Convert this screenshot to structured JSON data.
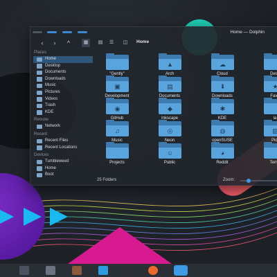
{
  "window": {
    "title": "Home — Dolphin",
    "breadcrumb": "Home"
  },
  "sidebar": {
    "sections": [
      {
        "label": "Places",
        "items": [
          {
            "label": "Home",
            "icon": "home-icon",
            "active": true
          },
          {
            "label": "Desktop",
            "icon": "desktop-icon"
          },
          {
            "label": "Documents",
            "icon": "documents-icon"
          },
          {
            "label": "Downloads",
            "icon": "downloads-icon"
          },
          {
            "label": "Music",
            "icon": "music-icon"
          },
          {
            "label": "Pictures",
            "icon": "pictures-icon"
          },
          {
            "label": "Videos",
            "icon": "videos-icon"
          },
          {
            "label": "Trash",
            "icon": "trash-icon"
          },
          {
            "label": "KDE",
            "icon": "kde-icon"
          }
        ]
      },
      {
        "label": "Remote",
        "items": [
          {
            "label": "Network",
            "icon": "network-icon"
          }
        ]
      },
      {
        "label": "Recent",
        "items": [
          {
            "label": "Recent Files",
            "icon": "recent-files-icon"
          },
          {
            "label": "Recent Locations",
            "icon": "recent-locations-icon"
          }
        ]
      },
      {
        "label": "Devices",
        "items": [
          {
            "label": "Tumbleweed",
            "icon": "drive-icon"
          },
          {
            "label": "Home",
            "icon": "drive-icon"
          },
          {
            "label": "Boot",
            "icon": "drive-icon"
          }
        ]
      }
    ]
  },
  "files": [
    {
      "label": "\"Gently\"",
      "glyph": ""
    },
    {
      "label": "Arch",
      "glyph": "▲"
    },
    {
      "label": "Cloud",
      "glyph": "☁"
    },
    {
      "label": "Desk",
      "glyph": ""
    },
    {
      "label": "Development",
      "glyph": "▣"
    },
    {
      "label": "Documents",
      "glyph": "▤"
    },
    {
      "label": "Downloads",
      "glyph": "⬇"
    },
    {
      "label": "Favo",
      "glyph": "★"
    },
    {
      "label": "GitHub",
      "glyph": "◉"
    },
    {
      "label": "Inkscape",
      "glyph": "◆"
    },
    {
      "label": "KDE",
      "glyph": "✱"
    },
    {
      "label": "la",
      "glyph": ""
    },
    {
      "label": "Music",
      "glyph": "♫"
    },
    {
      "label": "Neon",
      "glyph": "◎"
    },
    {
      "label": "openSUSE",
      "glyph": "◍"
    },
    {
      "label": "Pict",
      "glyph": "▧"
    },
    {
      "label": "Projects",
      "glyph": ""
    },
    {
      "label": "Public",
      "glyph": "☺"
    },
    {
      "label": "Reddit",
      "glyph": "◕"
    },
    {
      "label": "Temp",
      "glyph": ""
    }
  ],
  "status": {
    "count": "25 Folders",
    "zoom_label": "Zoom:",
    "zoom_level": 0.2
  },
  "taskbar": {
    "items": [
      "app-launcher-icon",
      "system-settings-icon",
      "discover-icon",
      "files-icon",
      "terminal-icon",
      "firefox-icon",
      "dolphin-icon"
    ]
  },
  "colors": {
    "accent": "#3d9be6",
    "folder": "#5aa4dd",
    "selection": "#2f5679"
  }
}
